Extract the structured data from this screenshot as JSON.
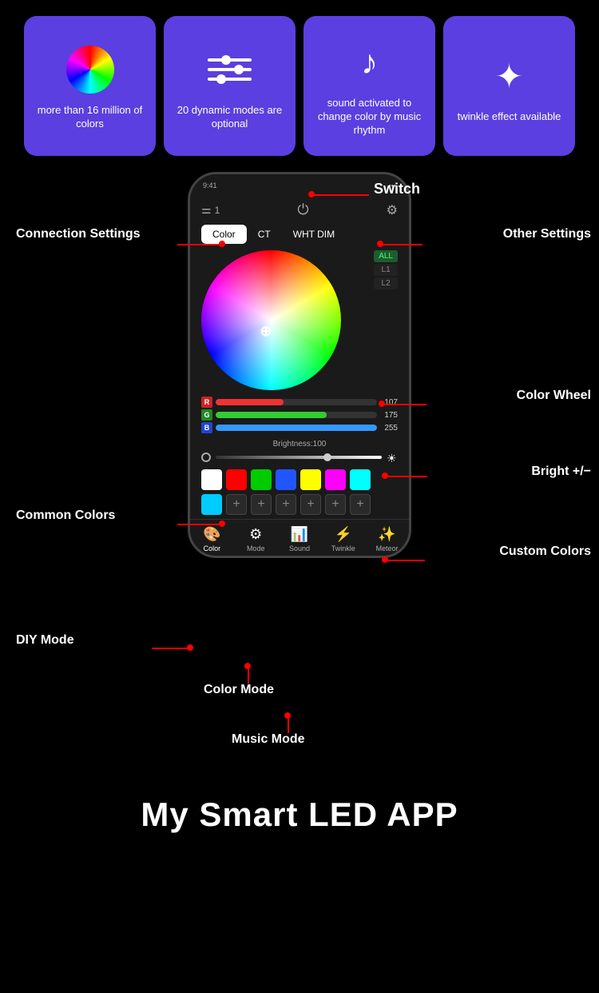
{
  "features": [
    {
      "id": "colors",
      "icon": "sphere",
      "text": "more than 16 million of colors"
    },
    {
      "id": "modes",
      "icon": "sliders",
      "text": "20 dynamic modes are optional"
    },
    {
      "id": "sound",
      "icon": "music",
      "text": "sound activated to change color by music rhythm"
    },
    {
      "id": "twinkle",
      "icon": "sparkle",
      "text": "twinkle effect available"
    }
  ],
  "annotations": {
    "switch": "Switch",
    "connection_settings": "Connection Settings",
    "other_settings": "Other Settings",
    "color_wheel": "Color Wheel",
    "bright": "Bright +/−",
    "common_colors": "Common Colors",
    "custom_colors": "Custom Colors",
    "diy_mode": "DIY Mode",
    "color_mode": "Color Mode",
    "music_mode": "Music Mode"
  },
  "phone": {
    "header_icon_left": "≡",
    "header_number": "1",
    "tabs": [
      "Color",
      "CT",
      "WHT DIM"
    ],
    "active_tab": "Color",
    "segments": [
      "ALL",
      "L1",
      "L2"
    ],
    "active_segment": "ALL",
    "rgb": [
      {
        "label": "R",
        "value": 107,
        "color": "#e33",
        "fill_pct": 42
      },
      {
        "label": "G",
        "value": 175,
        "color": "#3c3",
        "fill_pct": 69
      },
      {
        "label": "B",
        "value": 255,
        "color": "#39f",
        "fill_pct": 100
      }
    ],
    "brightness_label": "Brightness:100",
    "common_colors": [
      "#ffffff",
      "#ff0000",
      "#00dd00",
      "#2255ff",
      "#ffff00",
      "#ff00ff",
      "#00ffff"
    ],
    "custom_color": "#00ccff",
    "custom_plus_count": 6,
    "nav_items": [
      {
        "label": "Color",
        "icon": "🎨",
        "active": true
      },
      {
        "label": "Mode",
        "icon": "⚙️",
        "active": false
      },
      {
        "label": "Sound",
        "icon": "📊",
        "active": false
      },
      {
        "label": "Twinkle",
        "icon": "⚡",
        "active": false
      },
      {
        "label": "Meteor",
        "icon": "✨",
        "active": false
      }
    ]
  },
  "app_title": "My Smart LED APP"
}
